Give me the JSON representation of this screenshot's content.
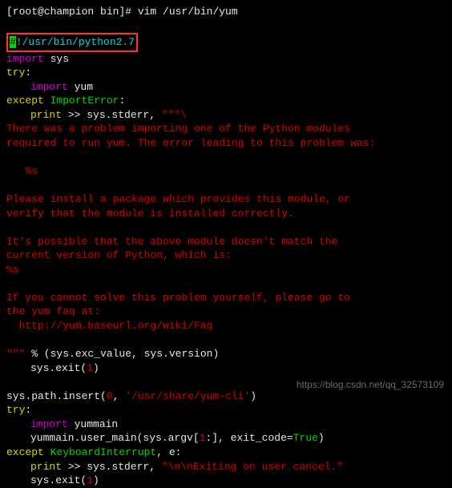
{
  "prompt": "[root@champion bin]# vim /usr/bin/yum",
  "shebang_cursor": "#",
  "shebang": "!/usr/bin/python2.7",
  "l_import": "import",
  "l_sys": " sys",
  "l_try": "try",
  "l_colon": ":",
  "l_yum": " yum",
  "l_except": "except",
  "l_ImportError": " ImportError",
  "l_print": "print",
  "l_stderr": " >> sys.stderr, ",
  "l_triq_open": "\"\"\"\\",
  "err1": "There was a problem importing one of the Python modules",
  "err2": "required to run yum. The error leading to this problem was:",
  "err3": "   %s",
  "err4": "Please install a package which provides this module, or",
  "err5": "verify that the module is installed correctly.",
  "err6": "It's possible that the above module doesn't match the",
  "err7": "current version of Python, which is:",
  "err8": "%s",
  "err9": "If you cannot solve this problem yourself, please go to",
  "err10": "the yum faq at:",
  "err11": "  http://yum.baseurl.org/wiki/Faq",
  "l_triq_close": "\"\"\"",
  "l_pct": " % (sys.exc_value, sys.version)",
  "l_sysexit": "sys.exit(",
  "l_one": "1",
  "l_close": ")",
  "l_pathinsert": "sys.path.insert(",
  "l_zero": "0",
  "l_comma": ", ",
  "l_sharepath": "'/usr/share/yum-cli'",
  "l_yummain": " yummain",
  "l_user_main": "yummain.user_main(sys.argv[",
  "l_slice": ":], exit_code=",
  "l_true": "True",
  "l_kbi": " KeyboardInterrupt",
  "l_e": ", e:",
  "l_exitmsg": "\"\\n\\nExiting on user cancel.\"",
  "watermark": "https://blog.csdn.net/qq_32573109"
}
